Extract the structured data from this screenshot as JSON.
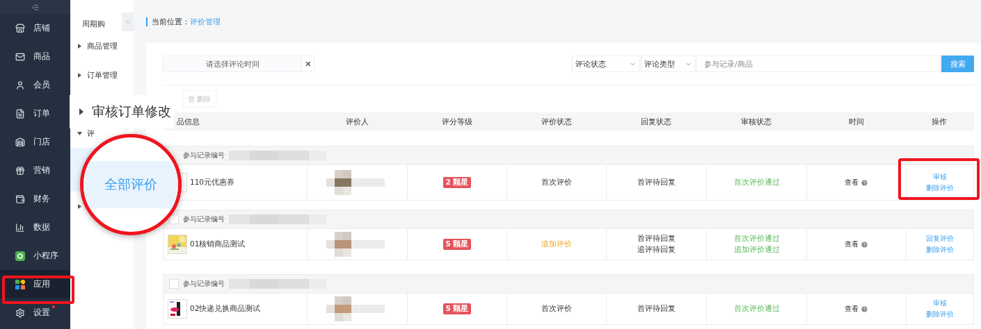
{
  "nav": {
    "items": [
      {
        "label": "店铺",
        "selected": false
      },
      {
        "label": "商品",
        "selected": false
      },
      {
        "label": "会员",
        "selected": false
      },
      {
        "label": "订单",
        "selected": false
      },
      {
        "label": "门店",
        "selected": false
      },
      {
        "label": "营销",
        "selected": false
      },
      {
        "label": "财务",
        "selected": false
      },
      {
        "label": "数据",
        "selected": false
      },
      {
        "label": "小程序",
        "selected": false
      },
      {
        "label": "应用",
        "selected": true,
        "highlighted": true
      },
      {
        "label": "设置",
        "selected": false,
        "dot": true
      }
    ]
  },
  "subnav": {
    "title": "周期购",
    "items": [
      {
        "label": "商品管理",
        "expanded": false
      },
      {
        "label": "订单管理",
        "expanded": false
      },
      {
        "label": "审核订单修改",
        "expanded": false,
        "magnified": true
      },
      {
        "label": "评",
        "expanded": true,
        "children": [
          {
            "label": "全部评价",
            "selected": true,
            "magnified": true
          }
        ]
      },
      {
        "expanded": false
      }
    ]
  },
  "breadcrumb": {
    "label": "当前位置：",
    "current": "评价管理"
  },
  "filters": {
    "date": {
      "placeholder": "请选择评论时间"
    },
    "selects": [
      "评论状态",
      "评论类型"
    ],
    "search": {
      "placeholder": "参与记录/商品"
    },
    "button": "搜索"
  },
  "toolbar": {
    "delete": {
      "label": "删除",
      "disabled": true
    }
  },
  "table": {
    "columns": [
      "品信息",
      "评价人",
      "评分等级",
      "评价状态",
      "回复状态",
      "审核状态",
      "时间",
      "操作"
    ],
    "groups": [
      {
        "record_label": "参与记录编号",
        "product": {
          "name": "110元优惠券"
        },
        "rating": "2 颗星",
        "eval_status": {
          "text": "首次评价",
          "kind": "first"
        },
        "reply_status": [
          "首评待回复"
        ],
        "audit_status": [
          "首次评价通过"
        ],
        "time": "查看",
        "actions": [
          "审核",
          "删除评价"
        ],
        "highlighted": true
      },
      {
        "record_label": "参与记录编号",
        "selected": false,
        "product": {
          "name": "01核销商品测试"
        },
        "rating": "5 颗星",
        "eval_status": {
          "text": "追加评价",
          "kind": "additional"
        },
        "reply_status": [
          "首评待回复",
          "追评待回复"
        ],
        "audit_status": [
          "首次评价通过",
          "追加评价通过"
        ],
        "time": "查看",
        "actions": [
          "回复评价",
          "删除评价"
        ]
      },
      {
        "record_label": "参与记录编号",
        "selected": false,
        "product": {
          "name": "02快递兑换商品测试"
        },
        "rating": "5 颗星",
        "eval_status": {
          "text": "首次评价",
          "kind": "first"
        },
        "reply_status": [
          "首评待回复"
        ],
        "audit_status": [
          "首次评价通过"
        ],
        "time": "查看",
        "actions": [
          "审核",
          "删除评价"
        ]
      }
    ]
  }
}
